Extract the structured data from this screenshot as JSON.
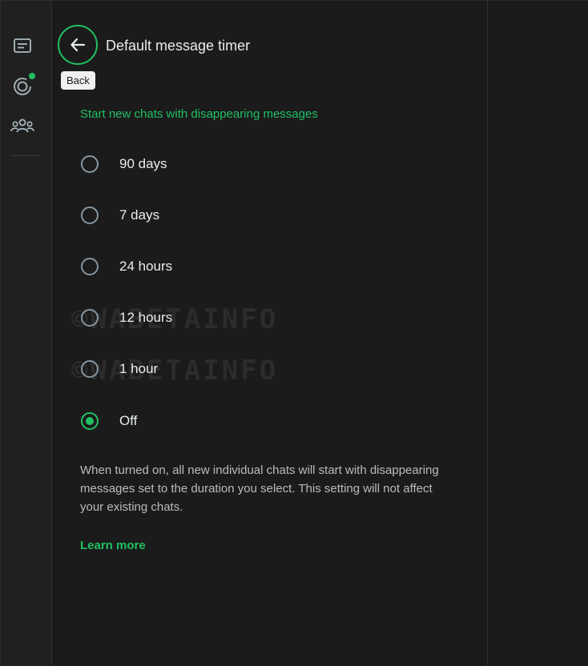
{
  "header": {
    "title": "Default message timer",
    "back_tooltip": "Back"
  },
  "sidebar": {
    "items": [
      {
        "name": "chats",
        "icon": "chat-icon"
      },
      {
        "name": "status",
        "icon": "status-icon",
        "has_indicator": true
      },
      {
        "name": "communities",
        "icon": "communities-icon"
      }
    ]
  },
  "section": {
    "title": "Start new chats with disappearing messages"
  },
  "options": [
    {
      "label": "90 days",
      "selected": false
    },
    {
      "label": "7 days",
      "selected": false
    },
    {
      "label": "24 hours",
      "selected": false
    },
    {
      "label": "12 hours",
      "selected": false
    },
    {
      "label": "1 hour",
      "selected": false
    },
    {
      "label": "Off",
      "selected": true
    }
  ],
  "description": "When turned on, all new individual chats will start with disappearing messages set to the duration you select. This setting will not affect your existing chats.",
  "learn_more": "Learn more",
  "watermark": "©WABETAINFO",
  "colors": {
    "accent": "#21c063",
    "background": "#1b1b1b",
    "text": "#e9edef"
  }
}
